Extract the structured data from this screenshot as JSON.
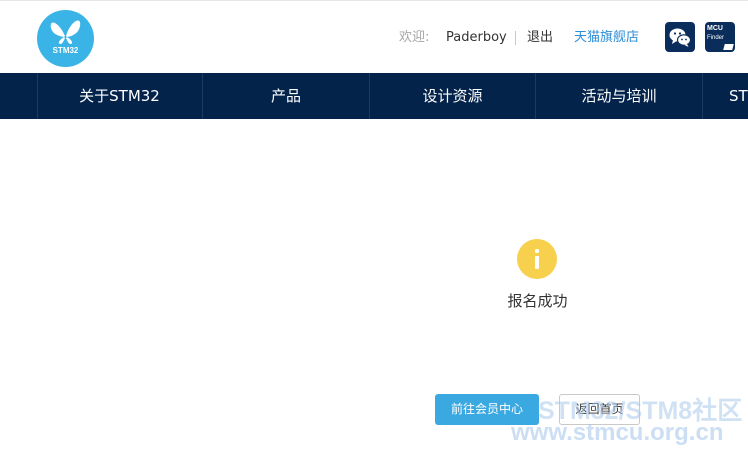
{
  "header": {
    "logo_text": "STM32",
    "welcome_label": "欢迎:",
    "username": "Paderboy",
    "logout_label": "退出",
    "tmall_label": "天猫旗舰店",
    "wechat_icon": "wechat-icon",
    "mcu_finder": {
      "line1": "MCU",
      "line2": "Finder"
    }
  },
  "nav": {
    "items": [
      {
        "label": "关于STM32"
      },
      {
        "label": "产品"
      },
      {
        "label": "设计资源"
      },
      {
        "label": "活动与培训"
      },
      {
        "label": "ST"
      }
    ]
  },
  "main": {
    "status_icon": "info-icon",
    "status_text": "报名成功",
    "primary_button": "前往会员中心",
    "secondary_button": "返回首页"
  },
  "watermark": {
    "line1": "STM32/STM8社区",
    "line2": "www.stmcu.org.cn"
  },
  "colors": {
    "nav_bg": "#03234b",
    "logo_blue": "#3ab4e6",
    "button_blue": "#3aa9e1",
    "info_yellow": "#f7d04d",
    "link_blue": "#2d8ed6"
  }
}
